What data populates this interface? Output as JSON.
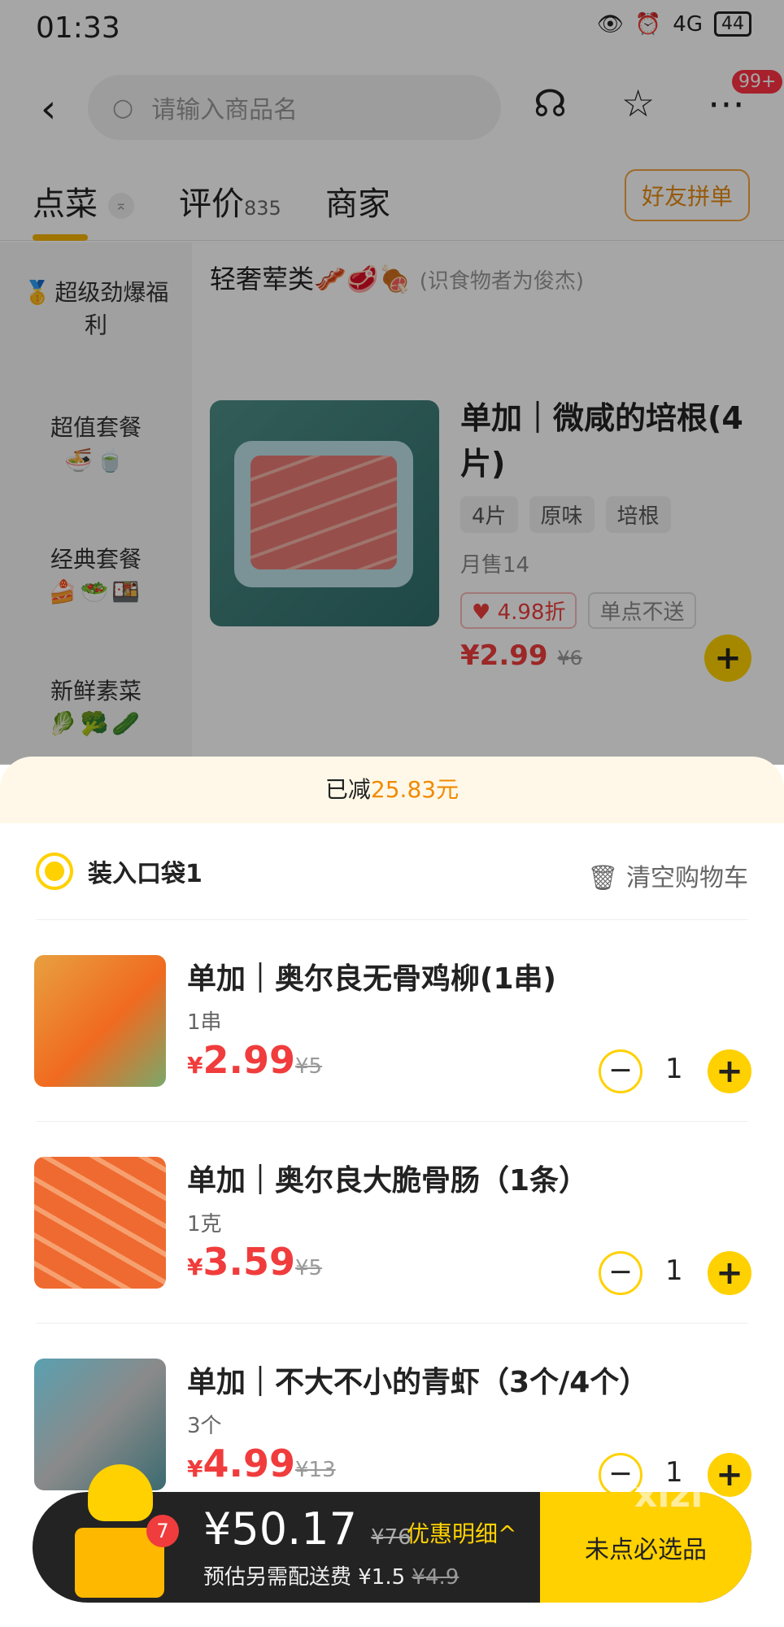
{
  "status": {
    "time": "01:33",
    "battery": "44",
    "signal": "4G"
  },
  "nav": {
    "search_placeholder": "请输入商品名",
    "more_badge": "99+"
  },
  "tabs": [
    {
      "label": "点菜"
    },
    {
      "label": "评价",
      "count": "835"
    },
    {
      "label": "商家"
    }
  ],
  "group_order": "好友拼单",
  "sidebar": [
    {
      "label": "超级劲爆福利",
      "emoji": "🥇"
    },
    {
      "label": "超值套餐",
      "emoji": "🍜🍵"
    },
    {
      "label": "经典套餐",
      "emoji": "🍰🥗🍱"
    },
    {
      "label": "新鲜素菜",
      "emoji": "🥬🥦🥒"
    }
  ],
  "category": {
    "title": "轻奢荤类🥓🥩🍖",
    "subtitle": "(识食物者为俊杰)"
  },
  "product": {
    "name": "单加｜微咸的培根(4片)",
    "tags": [
      "4片",
      "原味",
      "培根"
    ],
    "sales": "月售14",
    "discount": "4.98折",
    "no_single": "单点不送",
    "price": "¥2.99",
    "orig": "¥6"
  },
  "cart": {
    "saved_label": "已减",
    "saved_amount": "25.83元",
    "bag": "装入口袋1",
    "clear": "清空购物车",
    "items": [
      {
        "name": "单加｜奥尔良无骨鸡柳(1串)",
        "spec": "1串",
        "price": "2.99",
        "orig": "¥5",
        "qty": "1"
      },
      {
        "name": "单加｜奥尔良大脆骨肠（1条）",
        "spec": "1克",
        "price": "3.59",
        "orig": "¥5",
        "qty": "1"
      },
      {
        "name": "单加｜不大不小的青虾（3个/4个）",
        "spec": "3个",
        "price": "4.99",
        "orig": "¥13",
        "qty": "1"
      }
    ]
  },
  "bottom": {
    "count": "7",
    "total": "¥50.17",
    "orig_total": "¥76",
    "promo": "优惠明细",
    "delivery_label": "预估另需配送费 ¥1.5",
    "delivery_orig": "¥4.9",
    "checkout": "未点必选品"
  },
  "watermark": "xizi",
  "colors": {
    "accent": "#ffd100",
    "price": "#f03c3c",
    "promo_text": "#f08a00"
  }
}
